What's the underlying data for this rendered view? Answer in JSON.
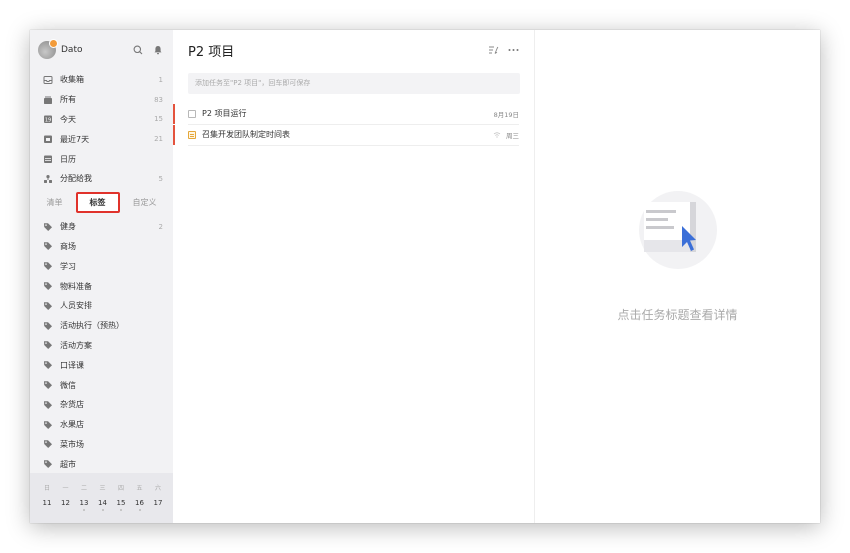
{
  "user": {
    "name": "Dato"
  },
  "nav": [
    {
      "label": "收集箱",
      "count": "1",
      "icon": "inbox-icon"
    },
    {
      "label": "所有",
      "count": "83",
      "icon": "all-icon"
    },
    {
      "label": "今天",
      "count": "15",
      "icon": "today-icon"
    },
    {
      "label": "最近7天",
      "count": "21",
      "icon": "week-icon"
    },
    {
      "label": "日历",
      "count": "",
      "icon": "calendar-icon"
    },
    {
      "label": "分配给我",
      "count": "5",
      "icon": "assigned-icon"
    }
  ],
  "tabs": {
    "list": "清单",
    "tags": "标签",
    "custom": "自定义"
  },
  "tags": [
    {
      "label": "健身",
      "count": "2"
    },
    {
      "label": "商场",
      "count": ""
    },
    {
      "label": "学习",
      "count": ""
    },
    {
      "label": "物料准备",
      "count": ""
    },
    {
      "label": "人员安排",
      "count": ""
    },
    {
      "label": "活动执行（预热）",
      "count": ""
    },
    {
      "label": "活动方案",
      "count": ""
    },
    {
      "label": "口译课",
      "count": ""
    },
    {
      "label": "微信",
      "count": ""
    },
    {
      "label": "杂货店",
      "count": ""
    },
    {
      "label": "水果店",
      "count": ""
    },
    {
      "label": "菜市场",
      "count": ""
    },
    {
      "label": "超市",
      "count": ""
    }
  ],
  "calendar": {
    "weekdays": [
      "日",
      "一",
      "二",
      "三",
      "四",
      "五",
      "六"
    ],
    "days": [
      "11",
      "12",
      "13",
      "14",
      "15",
      "16",
      "17"
    ]
  },
  "list": {
    "title": "P2 项目",
    "add_placeholder": "添加任务至\"P2 项目\"，回车即可保存",
    "tasks": [
      {
        "title": "P2 项目运行",
        "date": "8月19日"
      },
      {
        "title": "召集开发团队制定时间表",
        "date": "周三"
      }
    ]
  },
  "detail": {
    "empty_text": "点击任务标题查看详情"
  },
  "colors": {
    "accent": "#3b7be0",
    "highlight_border": "#e0322b",
    "priority": "#e4533d",
    "sidebar_bg": "#f2f2f4"
  }
}
